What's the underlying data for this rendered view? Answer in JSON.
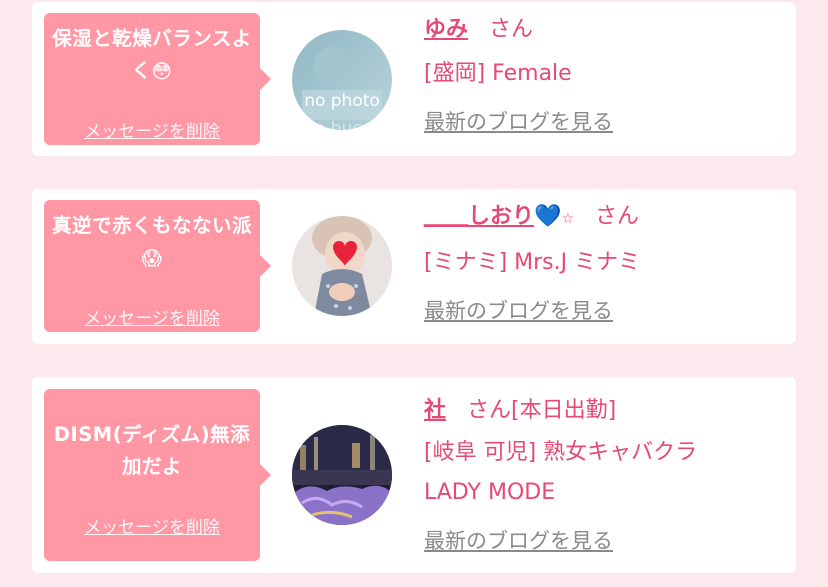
{
  "rows": [
    {
      "message": "保湿と乾燥バランスよく",
      "message_emoji": "😳",
      "delete_label": "メッセージを削除",
      "name": "ゆみ",
      "honorific": "さん",
      "extra": "",
      "shop": "[盛岡] Female",
      "shop_cont": "",
      "blog_label": "最新のブログを見る",
      "avatar_text": "no photo"
    },
    {
      "message": "真逆で赤くもなない派",
      "message_emoji": "😱",
      "delete_label": "メッセージを削除",
      "name_prefix": "＿＿",
      "name": "しおり",
      "name_emoji": "💙",
      "name_star": "☆",
      "honorific": "さん",
      "extra": "",
      "shop": "[ミナミ] Mrs.J ミナミ",
      "shop_cont": "",
      "blog_label": "最新のブログを見る"
    },
    {
      "message": "DISM(ディズム)無添加だよ",
      "message_emoji": "",
      "delete_label": "メッセージを削除",
      "name": "社",
      "honorific": "さん",
      "extra": "[本日出勤]",
      "shop": "[岐阜 可児] 熟女キャバクラ",
      "shop_cont": "LADY MODE",
      "blog_label": "最新のブログを見る"
    }
  ],
  "colors": {
    "bubble": "#ff97a5",
    "accent": "#e64975",
    "link_gray": "#8a8a8a",
    "page_bg": "#fce9ee"
  }
}
